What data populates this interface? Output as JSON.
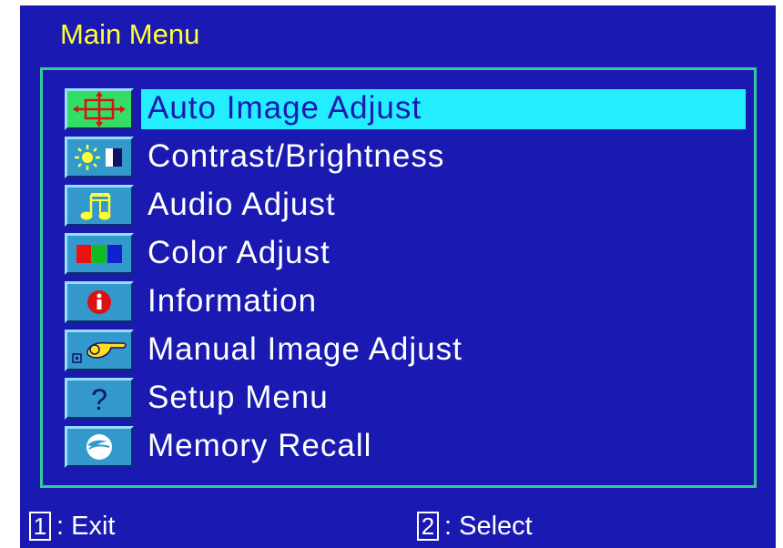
{
  "title": "Main Menu",
  "menu": [
    {
      "label": "Auto Image Adjust",
      "icon": "auto-adjust-icon"
    },
    {
      "label": "Contrast/Brightness",
      "icon": "brightness-icon"
    },
    {
      "label": "Audio Adjust",
      "icon": "audio-icon"
    },
    {
      "label": "Color Adjust",
      "icon": "color-bars-icon"
    },
    {
      "label": "Information",
      "icon": "info-icon"
    },
    {
      "label": "Manual Image Adjust",
      "icon": "manual-adjust-icon"
    },
    {
      "label": "Setup Menu",
      "icon": "question-icon"
    },
    {
      "label": "Memory Recall",
      "icon": "memory-recall-icon"
    }
  ],
  "selected_index": 0,
  "footer": {
    "exit_key": "1",
    "exit_label": ": Exit",
    "select_key": "2",
    "select_label": ": Select"
  },
  "colors": {
    "background": "#1a1ab2",
    "title": "#ffff33",
    "frame": "#33cc99",
    "highlight": "#22eeff",
    "selected_icon_bg": "#33dd66",
    "icon_bg": "#3399cc"
  }
}
